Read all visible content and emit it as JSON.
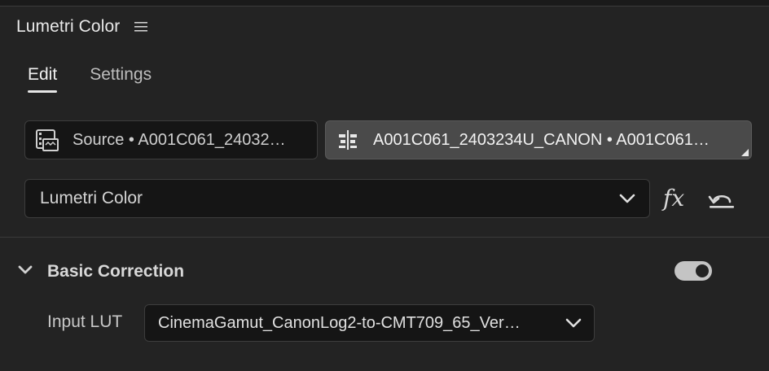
{
  "panel": {
    "title": "Lumetri Color",
    "menu_icon": "hamburger-menu-icon"
  },
  "tabs": [
    {
      "label": "Edit",
      "active": true
    },
    {
      "label": "Settings",
      "active": false
    }
  ],
  "clips": {
    "source": {
      "label": "Source • A001C061_24032…",
      "icon": "clip-film-icon"
    },
    "sequence": {
      "label": "A001C061_2403234U_CANON • A001C061…",
      "icon": "timeline-clip-icon"
    }
  },
  "effect_select": {
    "value": "Lumetri Color",
    "icon": "chevron-down-icon"
  },
  "toolbar": {
    "fx_label": "fx",
    "reset_icon": "reset-icon"
  },
  "section": {
    "title": "Basic Correction",
    "expanded": true,
    "enabled": true
  },
  "input_lut": {
    "label": "Input LUT",
    "value": "CinemaGamut_CanonLog2-to-CMT709_65_Ver…"
  }
}
